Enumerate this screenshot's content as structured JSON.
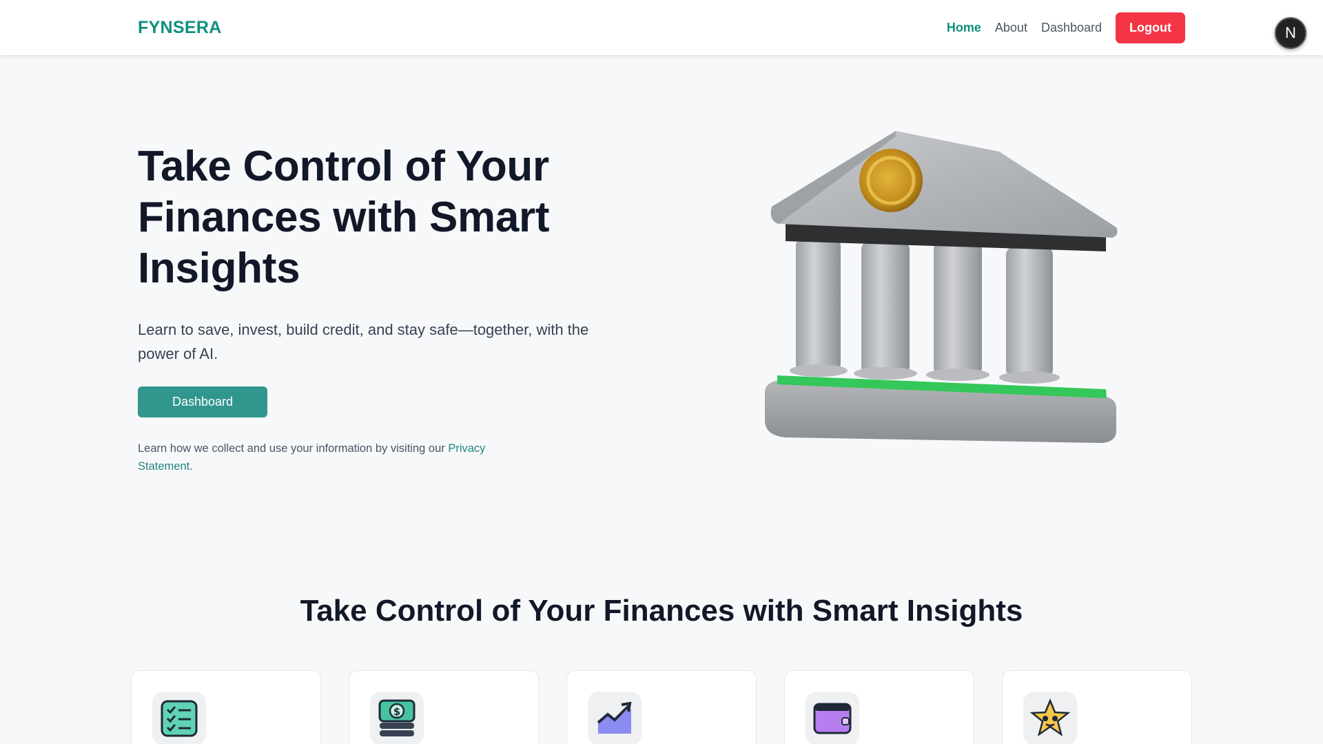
{
  "navbar": {
    "brand": "FYNSERA",
    "links": [
      {
        "label": "Home",
        "active": true
      },
      {
        "label": "About",
        "active": false
      },
      {
        "label": "Dashboard",
        "active": false
      }
    ],
    "logout_label": "Logout",
    "avatar_letter": "N"
  },
  "hero": {
    "title": "Take Control of Your Finances with Smart Insights",
    "subtitle": "Learn to save, invest, build credit, and stay safe—together, with the power of AI.",
    "cta_label": "Dashboard",
    "privacy_text": "Learn how we collect and use your information by visiting our ",
    "privacy_link": "Privacy Statement",
    "privacy_end": "."
  },
  "features": {
    "title": "Take Control of Your Finances with Smart Insights",
    "cards": [
      {
        "icon": "checklist-icon"
      },
      {
        "icon": "money-stack-icon"
      },
      {
        "icon": "chart-up-icon"
      },
      {
        "icon": "wallet-icon"
      },
      {
        "icon": "star-face-icon"
      }
    ]
  },
  "colors": {
    "brand": "#0f8f7e",
    "primary_button": "#31968e",
    "logout": "#f43545",
    "background": "#f7f8fa"
  }
}
